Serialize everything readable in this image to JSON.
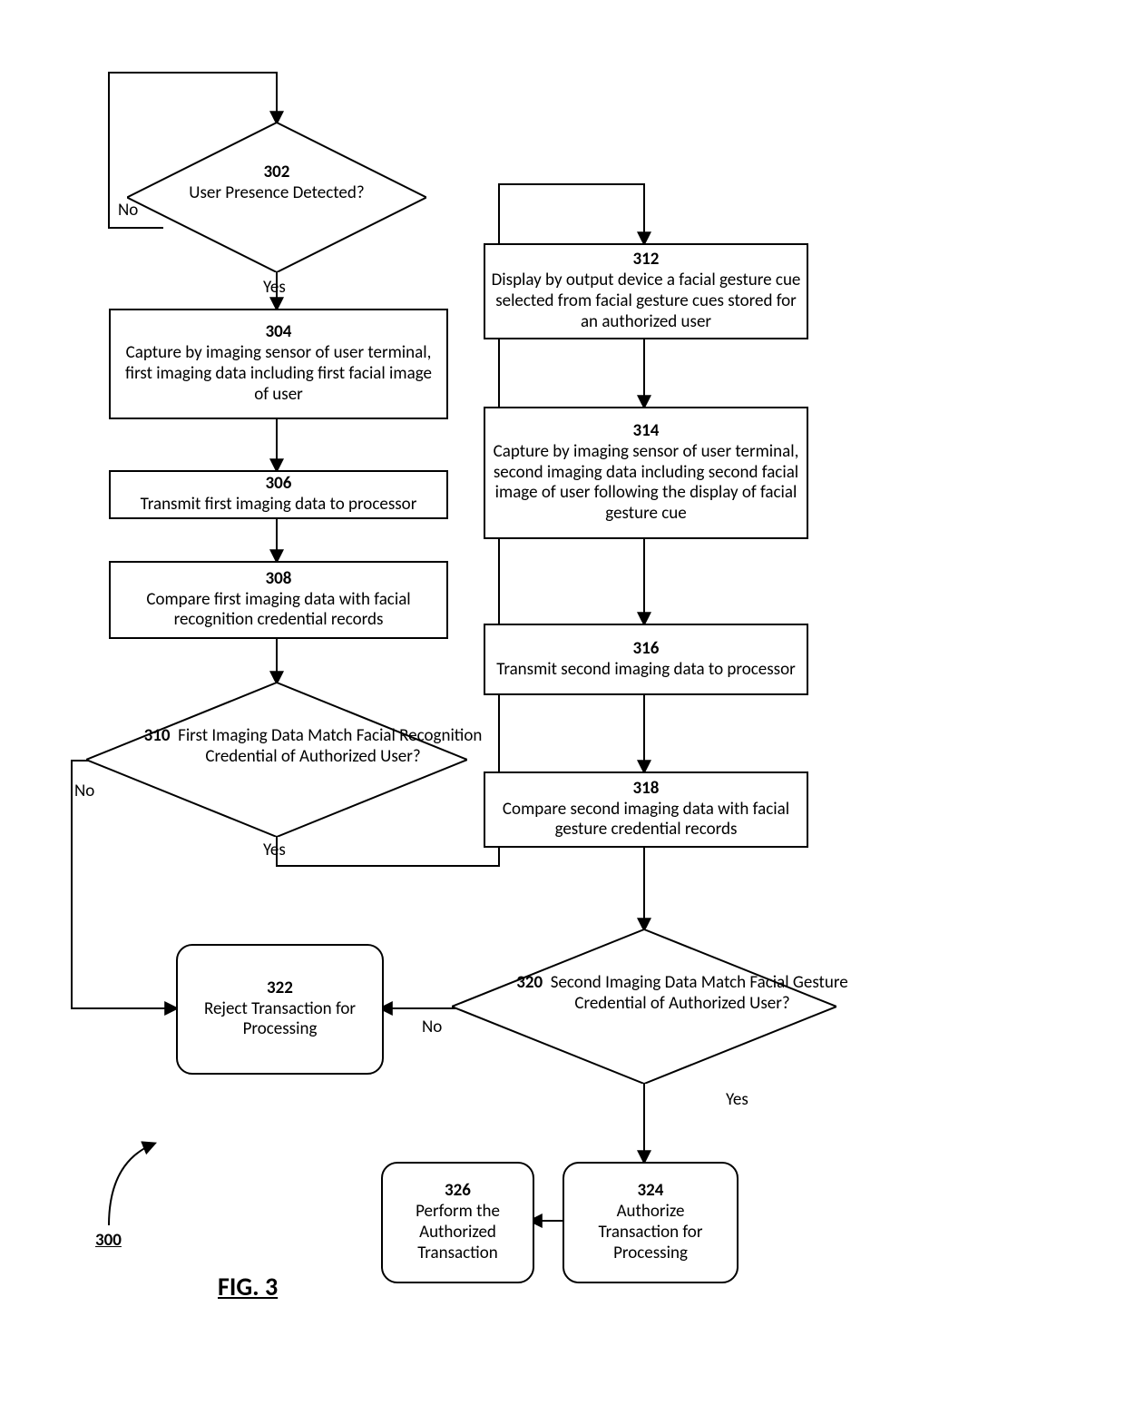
{
  "nodes": {
    "n302": {
      "num": "302",
      "text": "User Presence Detected?"
    },
    "n304": {
      "num": "304",
      "text": "Capture by imaging sensor of user terminal, first imaging data including first facial image of user"
    },
    "n306": {
      "num": "306",
      "text": "Transmit first imaging data to processor"
    },
    "n308": {
      "num": "308",
      "text": "Compare first imaging data with facial recognition credential records"
    },
    "n310": {
      "num": "310",
      "text": "First Imaging Data Match Facial Recognition Credential of Authorized User?"
    },
    "n312": {
      "num": "312",
      "text": "Display by output device a facial gesture cue selected from facial gesture cues stored for an authorized user"
    },
    "n314": {
      "num": "314",
      "text": "Capture by imaging sensor of user terminal, second imaging data including second facial image of user following the display of facial gesture cue"
    },
    "n316": {
      "num": "316",
      "text": "Transmit second imaging data to processor"
    },
    "n318": {
      "num": "318",
      "text": "Compare second imaging data with facial gesture credential records"
    },
    "n320": {
      "num": "320",
      "text": "Second Imaging Data Match Facial Gesture Credential of Authorized User?"
    },
    "n322": {
      "num": "322",
      "text": "Reject Transaction for Processing"
    },
    "n324": {
      "num": "324",
      "text": "Authorize Transaction for Processing"
    },
    "n326": {
      "num": "326",
      "text": "Perform the Authorized Transaction"
    }
  },
  "labels": {
    "no": "No",
    "yes": "Yes"
  },
  "ref": "300",
  "fig": "FIG. 3"
}
